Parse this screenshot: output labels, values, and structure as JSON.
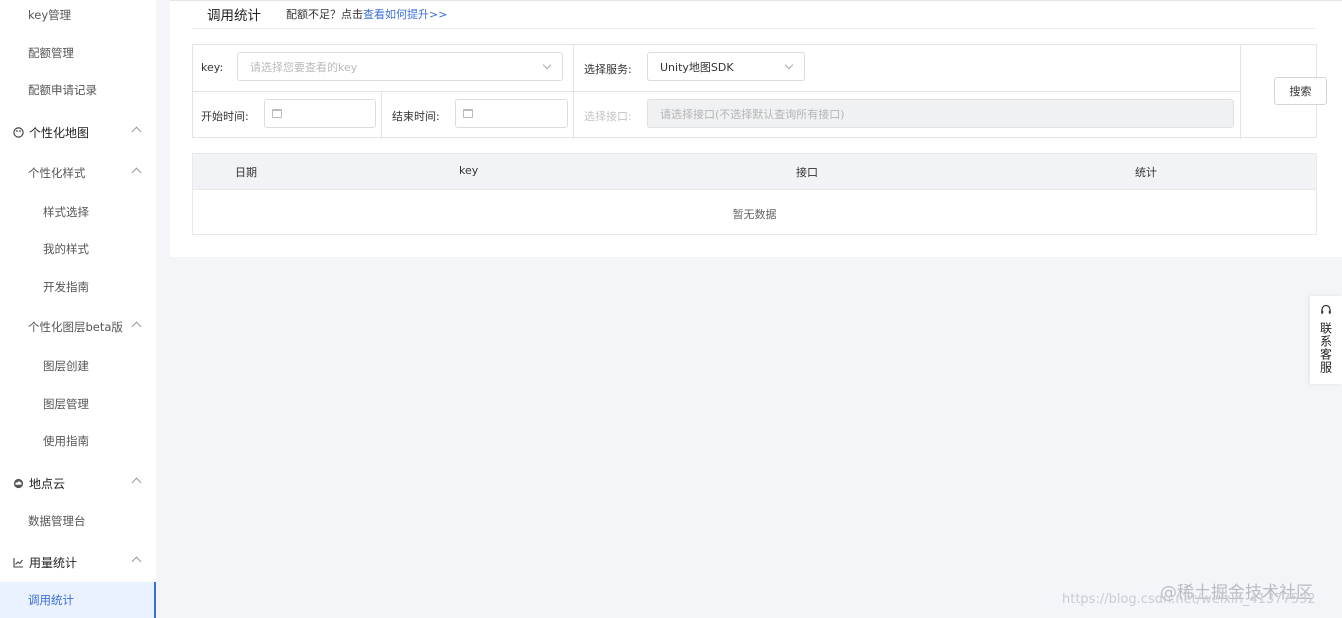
{
  "sidebar": {
    "items": [
      {
        "label": "key管理"
      },
      {
        "label": "配额管理"
      },
      {
        "label": "配额申请记录"
      },
      {
        "label": "个性化地图"
      },
      {
        "label": "个性化样式"
      },
      {
        "label": "样式选择"
      },
      {
        "label": "我的样式"
      },
      {
        "label": "开发指南"
      },
      {
        "label": "个性化图层beta版"
      },
      {
        "label": "图层创建"
      },
      {
        "label": "图层管理"
      },
      {
        "label": "使用指南"
      },
      {
        "label": "地点云"
      },
      {
        "label": "数据管理台"
      },
      {
        "label": "用量统计"
      },
      {
        "label": "调用统计"
      }
    ]
  },
  "page": {
    "title": "调用统计",
    "quota_hint": "配额不足？点击",
    "quota_link": "查看如何提升>>"
  },
  "filter": {
    "key_label": "key:",
    "key_placeholder": "请选择您要查看的key",
    "service_label": "选择服务:",
    "service_value": "Unity地图SDK",
    "start_label": "开始时间:",
    "end_label": "结束时间:",
    "interface_label": "选择接口:",
    "interface_placeholder": "请选择接口(不选择默认查询所有接口)",
    "search_label": "搜索"
  },
  "table": {
    "columns": [
      "日期",
      "key",
      "接口",
      "统计"
    ],
    "empty_text": "暂无数据"
  },
  "contact": {
    "label": "联系客服"
  },
  "watermark": {
    "brand": "@稀土掘金技术社区",
    "url": "https://blog.csdn.net/weixin_41377532"
  }
}
